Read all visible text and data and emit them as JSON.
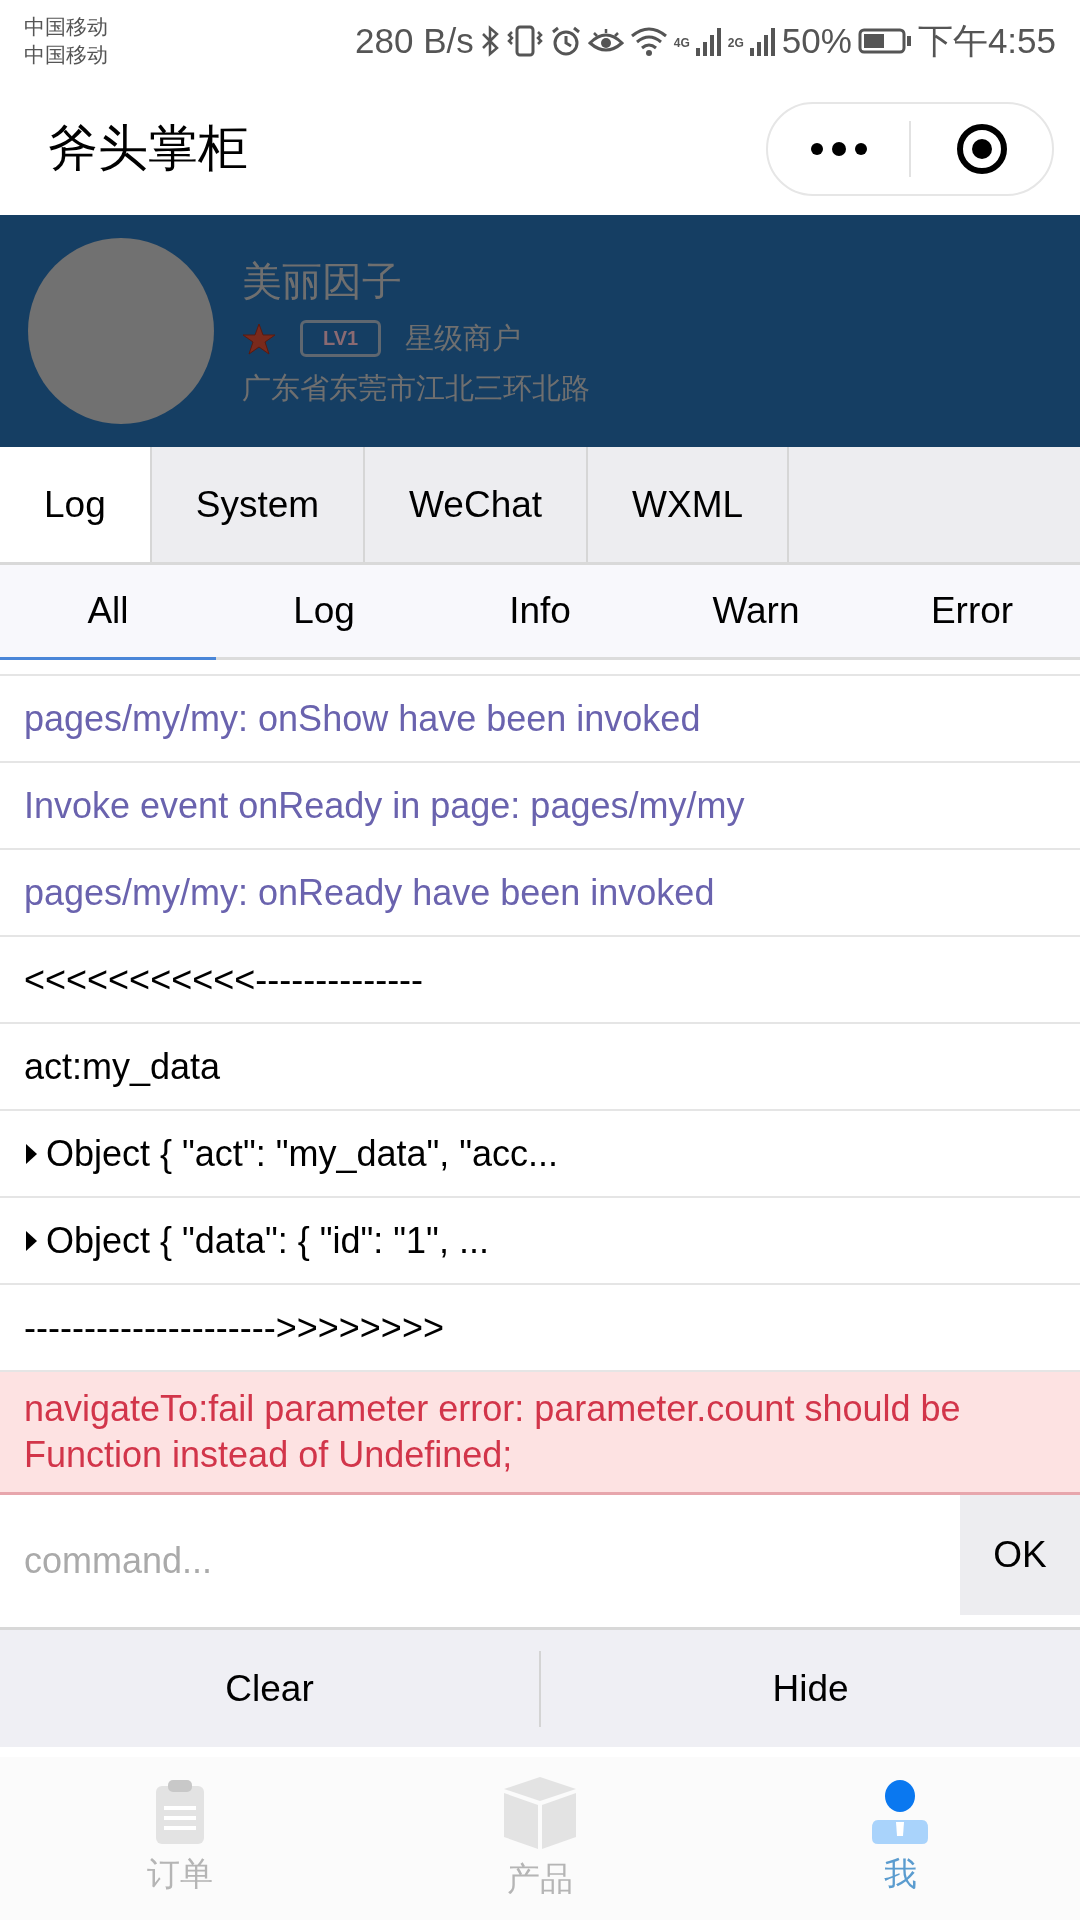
{
  "status_bar": {
    "carriers": [
      "中国移动",
      "中国移动"
    ],
    "speed": "280 B/s",
    "network_labels": [
      "4G",
      "2G"
    ],
    "battery": "50%",
    "time": "下午4:55"
  },
  "nav_bar": {
    "title": "斧头掌柜"
  },
  "profile": {
    "name": "美丽因子",
    "level": "LV1",
    "rank": "星级商户",
    "address": "广东省东莞市江北三环北路"
  },
  "console": {
    "tabs": [
      {
        "label": "Log",
        "selected": true
      },
      {
        "label": "System",
        "selected": false
      },
      {
        "label": "WeChat",
        "selected": false
      },
      {
        "label": "WXML",
        "selected": false
      }
    ],
    "filters": [
      {
        "label": "All",
        "selected": true
      },
      {
        "label": "Log",
        "selected": false
      },
      {
        "label": "Info",
        "selected": false
      },
      {
        "label": "Warn",
        "selected": false
      },
      {
        "label": "Error",
        "selected": false
      }
    ],
    "logs": [
      {
        "kind": "info",
        "text": "pages/my/my: onShow have been invoked"
      },
      {
        "kind": "info",
        "text": "Invoke event onReady in page: pages/my/my"
      },
      {
        "kind": "info",
        "text": "pages/my/my: onReady have been invoked"
      },
      {
        "kind": "log",
        "text": "<<<<<<<<<<<--------------"
      },
      {
        "kind": "log",
        "text": "act:my_data"
      },
      {
        "kind": "object",
        "text": "Object { \"act\": \"my_data\", \"acc..."
      },
      {
        "kind": "object",
        "text": "Object { \"data\": { \"id\": \"1\", ..."
      },
      {
        "kind": "log",
        "text": "--------------------->>>>>>>>"
      },
      {
        "kind": "error",
        "text": "navigateTo:fail parameter error: parameter.count should be Function instead of Undefined;"
      }
    ],
    "command": {
      "placeholder": "command...",
      "button": "OK"
    },
    "actions": [
      "Clear",
      "Hide"
    ]
  },
  "tab_bar": [
    {
      "kind": "clipboard",
      "label": "订单",
      "selected": false
    },
    {
      "kind": "box",
      "label": "产品",
      "selected": false
    },
    {
      "kind": "person",
      "label": "我",
      "selected": true
    }
  ]
}
